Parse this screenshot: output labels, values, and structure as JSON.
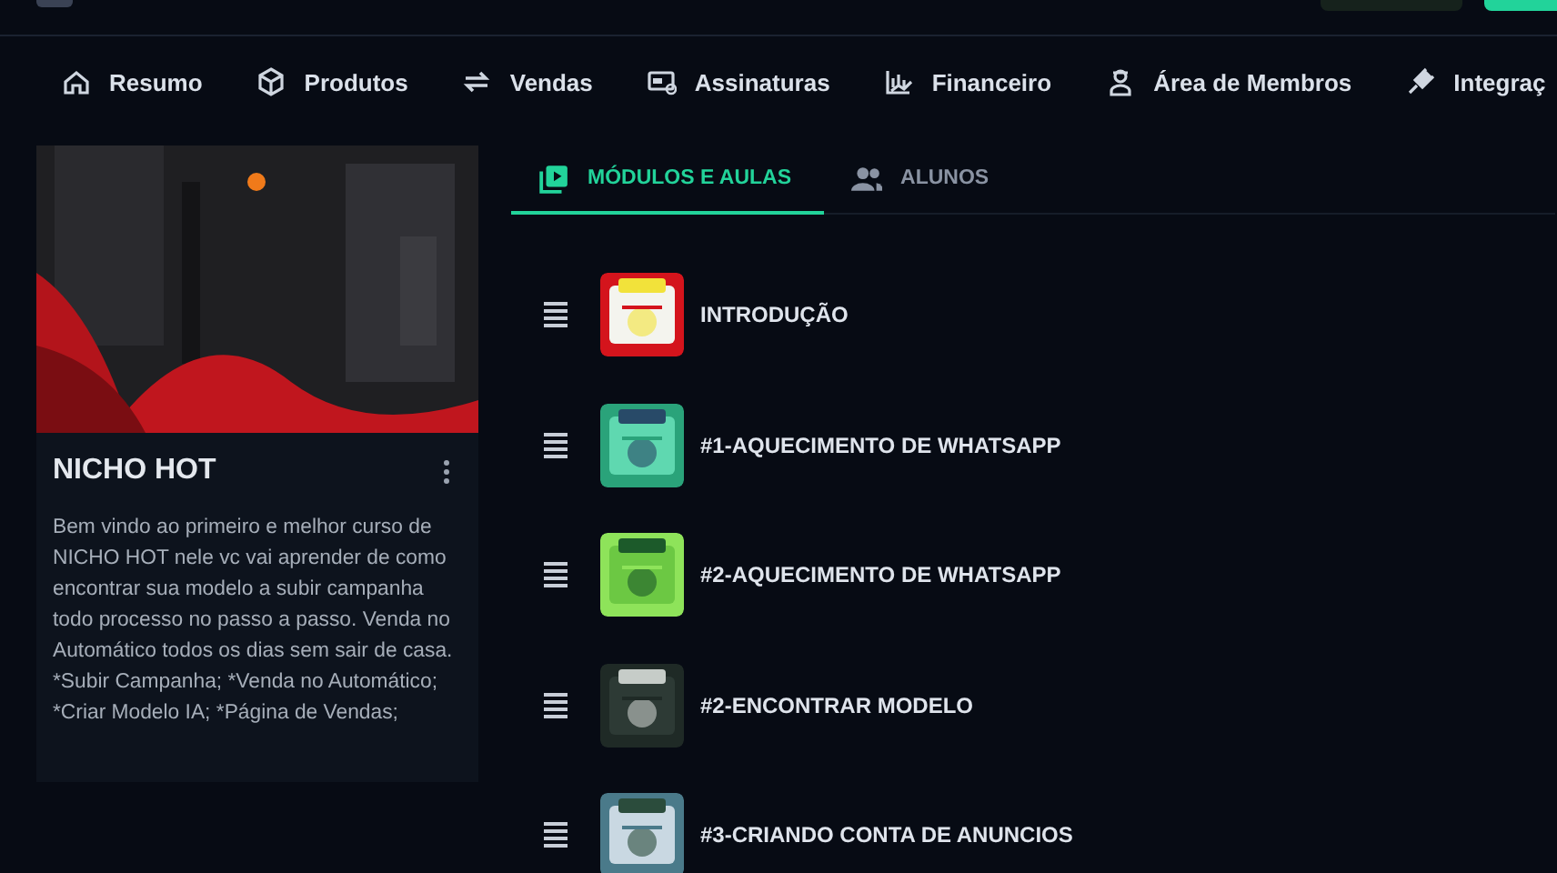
{
  "nav": [
    {
      "label": "Resumo"
    },
    {
      "label": "Produtos"
    },
    {
      "label": "Vendas"
    },
    {
      "label": "Assinaturas"
    },
    {
      "label": "Financeiro"
    },
    {
      "label": "Área de Membros"
    },
    {
      "label": "Integraç"
    }
  ],
  "course": {
    "title": "NICHO HOT",
    "description": "Bem vindo ao primeiro e melhor curso de NICHO HOT nele vc vai aprender de como encontrar sua modelo a subir campanha todo processo no passo a passo. Venda no Automático todos os dias sem sair de casa. *Subir Campanha; *Venda no Automático; *Criar Modelo IA; *Página de Vendas;"
  },
  "tabs": [
    {
      "label": "MÓDULOS E AULAS",
      "selected": true
    },
    {
      "label": "ALUNOS",
      "selected": false
    }
  ],
  "modules": [
    {
      "title": "INTRODUÇÃO"
    },
    {
      "title": "#1-AQUECIMENTO DE WHATSAPP"
    },
    {
      "title": "#2-AQUECIMENTO DE WHATSAPP"
    },
    {
      "title": "#2-ENCONTRAR MODELO"
    },
    {
      "title": "#3-CRIANDO CONTA DE ANUNCIOS"
    }
  ]
}
